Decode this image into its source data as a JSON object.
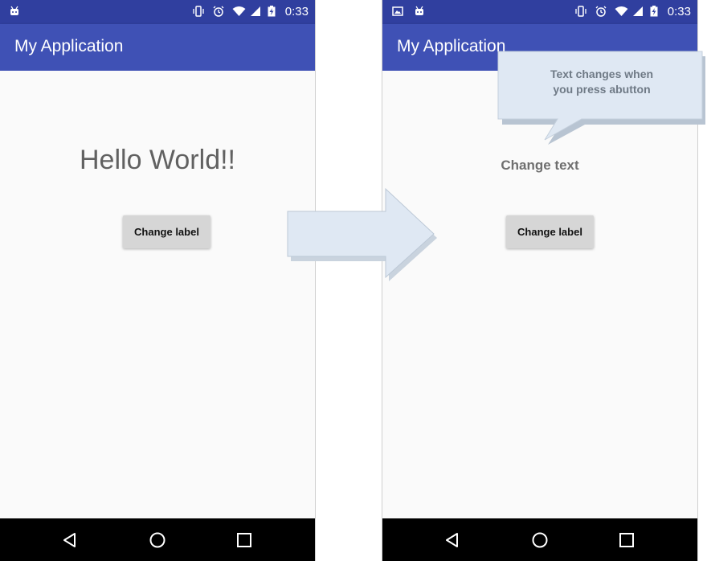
{
  "left_phone": {
    "status_time": "0:33",
    "app_title": "My Application",
    "main_text": "Hello World!!",
    "button_label": "Change label"
  },
  "right_phone": {
    "status_time": "0:33",
    "app_title": "My Application",
    "main_text": "Change text",
    "button_label": "Change label"
  },
  "annotation": {
    "callout_line1": "Text changes when",
    "callout_line2": "you press abutton"
  },
  "colors": {
    "status_bar": "#303f9f",
    "app_bar": "#3f51b5",
    "content_bg": "#fafafa",
    "button_bg": "#d6d6d6",
    "callout_fill": "#dfe8f3",
    "nav_bar": "#000000"
  },
  "icons": {
    "status_left": [
      "android-icon"
    ],
    "status_left_right_phone": [
      "image-icon",
      "android-icon"
    ],
    "status_right": [
      "vibrate-icon",
      "alarm-icon",
      "wifi-icon",
      "signal-icon",
      "battery-charging-icon"
    ],
    "nav": [
      "back-icon",
      "home-icon",
      "recents-icon"
    ]
  }
}
